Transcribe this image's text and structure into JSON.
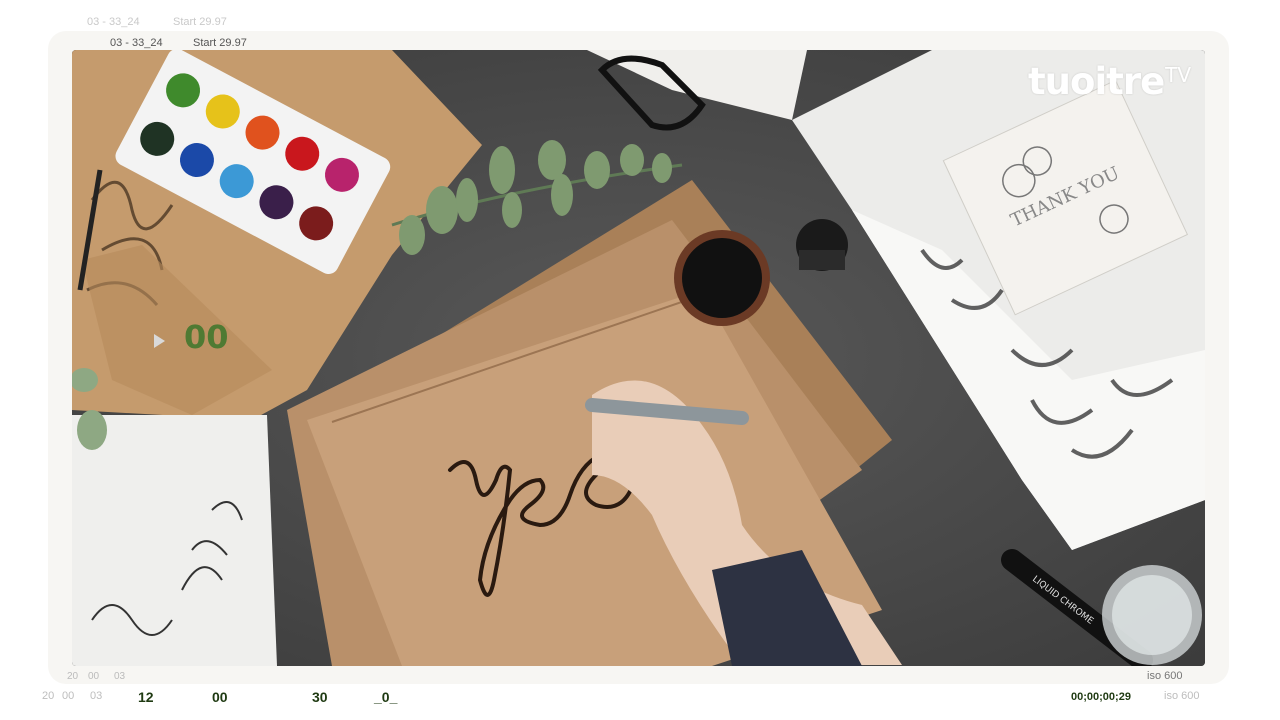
{
  "top_meta": {
    "ghost_code": "03 - 33_24",
    "ghost_start": "Start 29.97",
    "code": "03 - 33_24",
    "start": "Start 29.97"
  },
  "counter": "00",
  "logo": {
    "main": "tuoitre",
    "suffix": "TV"
  },
  "card": {
    "line1": "THANK YOU"
  },
  "handwriting": "yes",
  "marker_label": "LIQUID CHROME",
  "bottom_left_small": [
    "20",
    "00",
    "03"
  ],
  "bottom_bar": {
    "small": [
      "20",
      "00",
      "03"
    ],
    "markers": [
      "12",
      "00",
      "30",
      "_0_"
    ],
    "timecode": "00;00;00;29",
    "iso_inner": "iso 600",
    "iso_outer": "iso 600"
  },
  "colors": {
    "counter": "#4f7a33",
    "bottom_text": "#1f3a12",
    "kraft": "#c49a6c",
    "desk": "#4a4a4a"
  }
}
